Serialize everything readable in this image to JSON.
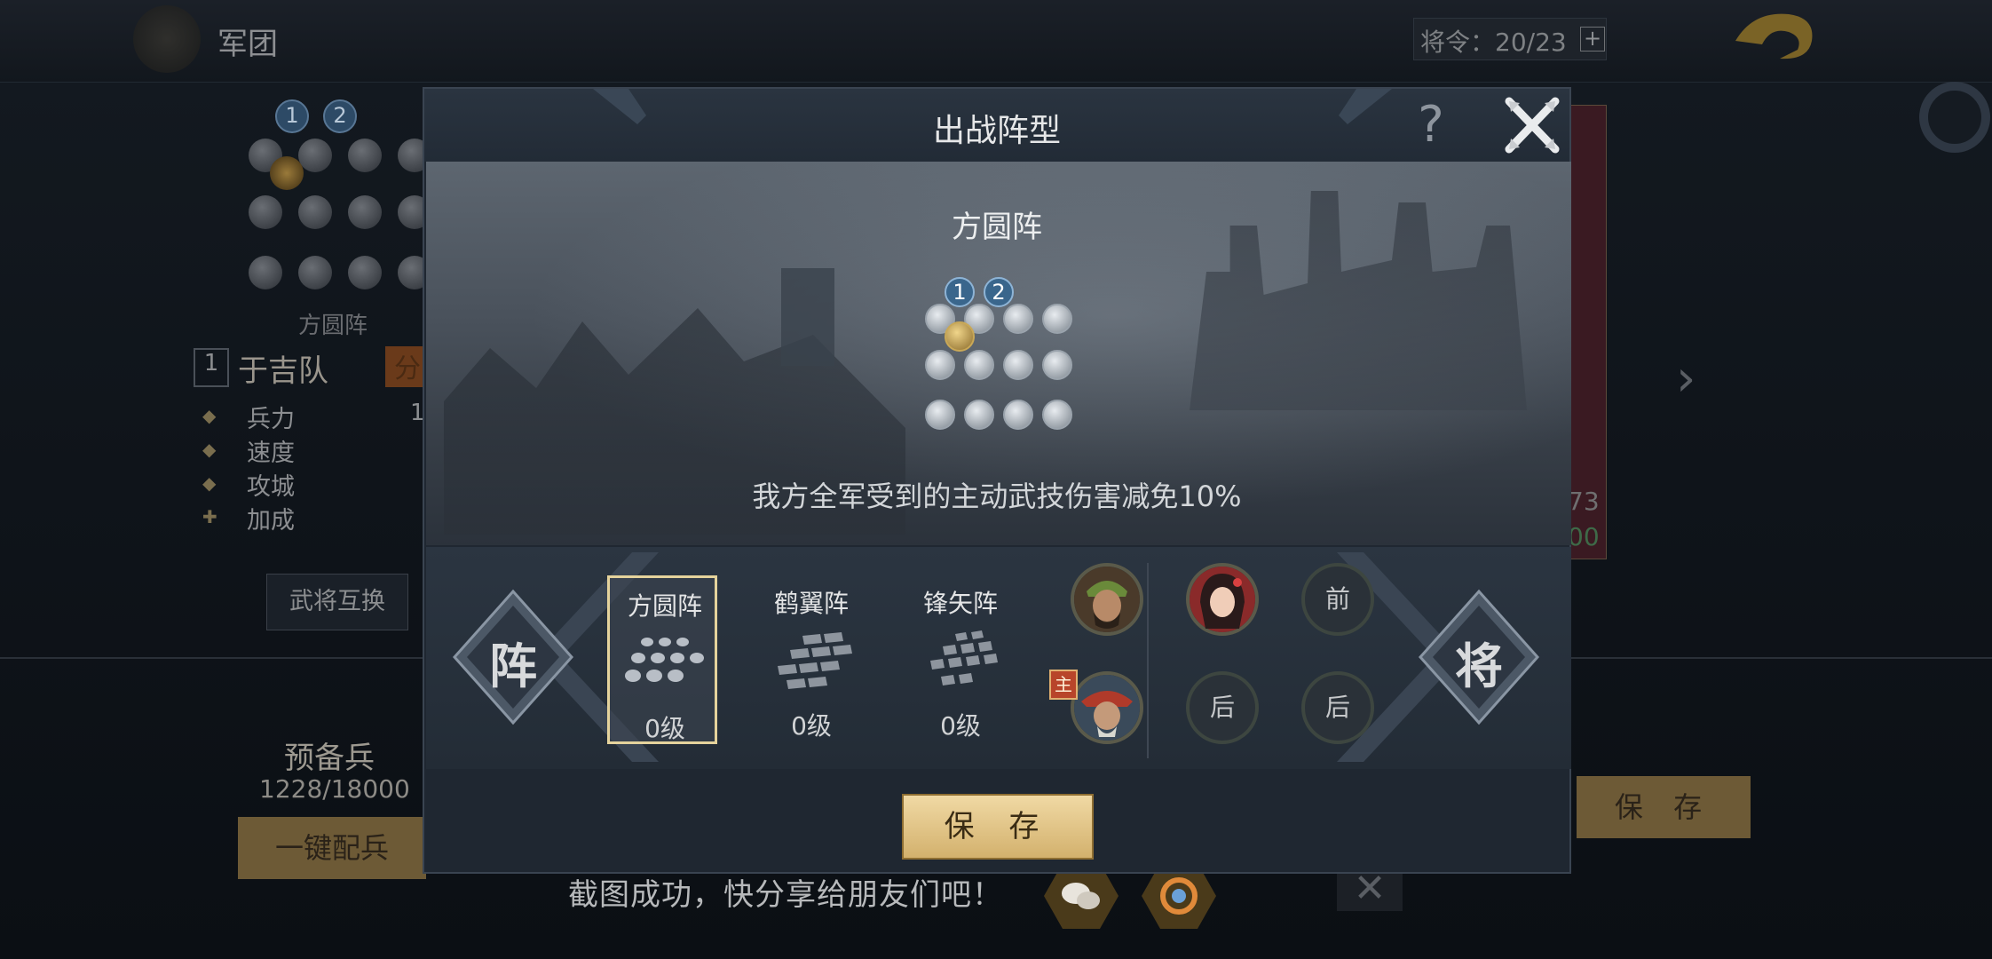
{
  "background": {
    "title": "军团",
    "orders": "将令：20/23",
    "orders_plus": "+",
    "formation_label": "方圆阵",
    "team_number": "1",
    "team_name": "于吉队",
    "team_tag": "分",
    "stats": [
      {
        "label": "兵力",
        "icon": "helmet-icon"
      },
      {
        "label": "速度",
        "icon": "horse-icon"
      },
      {
        "label": "攻城",
        "icon": "castle-icon"
      },
      {
        "label": "加成",
        "icon": "plus-icon"
      }
    ],
    "troop_digit": "1",
    "swap_generals_label": "武将互换",
    "reserve_label": "预备兵",
    "reserve_count": "1228/18000",
    "one_click_label": "一键配兵",
    "save_label": "保 存",
    "card_num_1": "73",
    "card_num_2": "00",
    "badges": [
      "1",
      "2"
    ]
  },
  "toast": {
    "text": "截图成功，快分享给朋友们吧！",
    "close_glyph": "✕"
  },
  "modal": {
    "title": "出战阵型",
    "help_glyph": "?",
    "formation_name": "方圆阵",
    "badges": [
      "1",
      "2"
    ],
    "description": "我方全军受到的主动武技伤害减免10%",
    "nav_left_label": "阵",
    "nav_right_label": "将",
    "formations": [
      {
        "name": "方圆阵",
        "level": "0级",
        "selected": true
      },
      {
        "name": "鹤翼阵",
        "level": "0级",
        "selected": false
      },
      {
        "name": "锋矢阵",
        "level": "0级",
        "selected": false
      }
    ],
    "slots": {
      "front_label": "前",
      "rear_label_1": "后",
      "rear_label_2": "后",
      "leader_badge": "主"
    },
    "save_label": "保 存"
  },
  "colors": {
    "accent_gold": "#e5d39c",
    "button_gold": "#d3b16d",
    "badge_blue": "#3a668c"
  }
}
